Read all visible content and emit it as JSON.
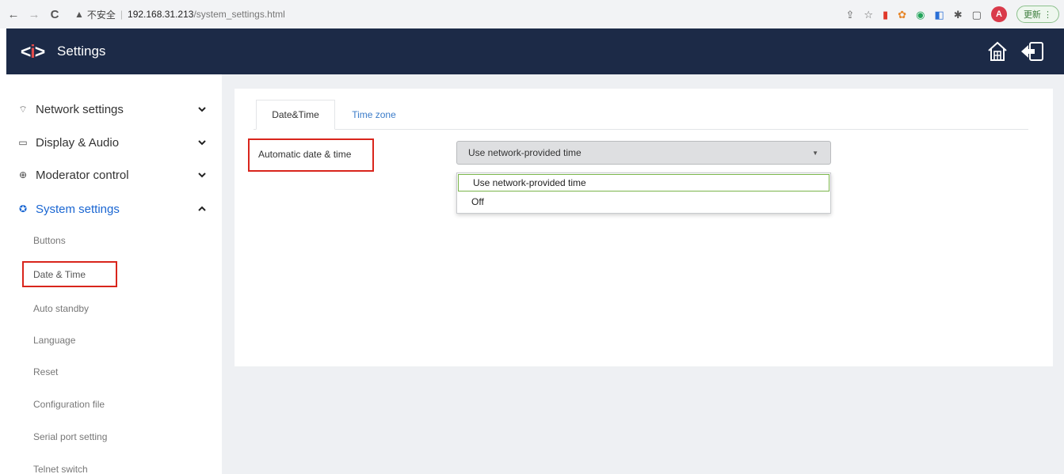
{
  "browser": {
    "back": "←",
    "forward": "→",
    "reload": "C",
    "warning_icon": "▲",
    "security": "不安全",
    "url_host": "192.168.31.213",
    "url_path": "/system_settings.html",
    "profile_initial": "A",
    "update_label": "更新 ⋮",
    "extensions": [
      "share-icon",
      "star-icon",
      "red-ext-icon",
      "orange-ext-icon",
      "green-ext-icon",
      "blue-ext-icon",
      "puzzle-icon",
      "sidebar-icon"
    ]
  },
  "header": {
    "title": "Settings",
    "logo_left": "<",
    "logo_mid": "i",
    "logo_right": ">",
    "background": "#1c2a47"
  },
  "sidebar": {
    "menu": [
      {
        "label": "Network settings",
        "icon": "wifi-icon",
        "glyph": "⌔",
        "expanded": false
      },
      {
        "label": "Display & Audio",
        "icon": "monitor-icon",
        "glyph": "▭",
        "expanded": false
      },
      {
        "label": "Moderator control",
        "icon": "globe-icon",
        "glyph": "⊕",
        "expanded": false
      },
      {
        "label": "System settings",
        "icon": "gear-icon",
        "glyph": "✪",
        "expanded": true
      }
    ],
    "submenu": [
      "Buttons",
      "Date & Time",
      "Auto standby",
      "Language",
      "Reset",
      "Configuration file",
      "Serial port setting",
      "Telnet switch"
    ],
    "active_color": "#1a66d2"
  },
  "main": {
    "tabs": [
      {
        "label": "Date&Time",
        "active": true
      },
      {
        "label": "Time zone",
        "active": false
      }
    ],
    "field_label": "Automatic date & time",
    "select_value": "Use network-provided time",
    "options": [
      "Use network-provided time",
      "Off"
    ],
    "highlight_color": "#d9251c"
  }
}
